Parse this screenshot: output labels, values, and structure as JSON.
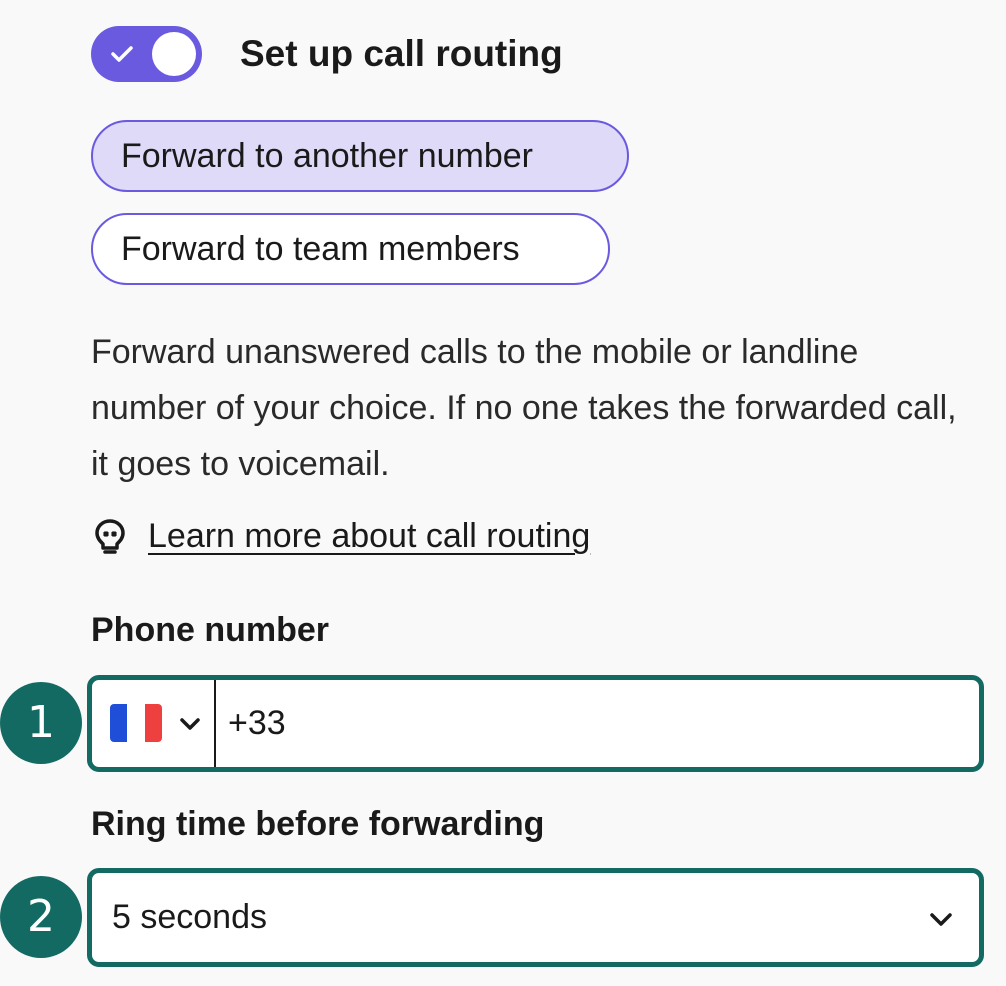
{
  "routing_toggle": {
    "label": "Set up call routing",
    "state": "on",
    "icon": "check-icon",
    "color": "#6a5ae0"
  },
  "routing_options": [
    {
      "label": "Forward to another number",
      "selected": true
    },
    {
      "label": "Forward to team members",
      "selected": false
    }
  ],
  "description": "Forward unanswered calls to the mobile or landline number of your choice. If no one takes the forwarded call, it goes to voicemail.",
  "learn_more": {
    "icon": "lightbulb-icon",
    "label": "Learn more about call routing"
  },
  "phone_number": {
    "label": "Phone number",
    "country_flag": "france-flag-icon",
    "value": "+33"
  },
  "ring_time": {
    "label": "Ring time before forwarding",
    "value": "5 seconds"
  },
  "step_badges": [
    "1",
    "2"
  ],
  "colors": {
    "accent": "#6a5ae0",
    "selected_fill": "#dedaf8",
    "focus_border": "#126a62",
    "badge": "#126a62"
  }
}
